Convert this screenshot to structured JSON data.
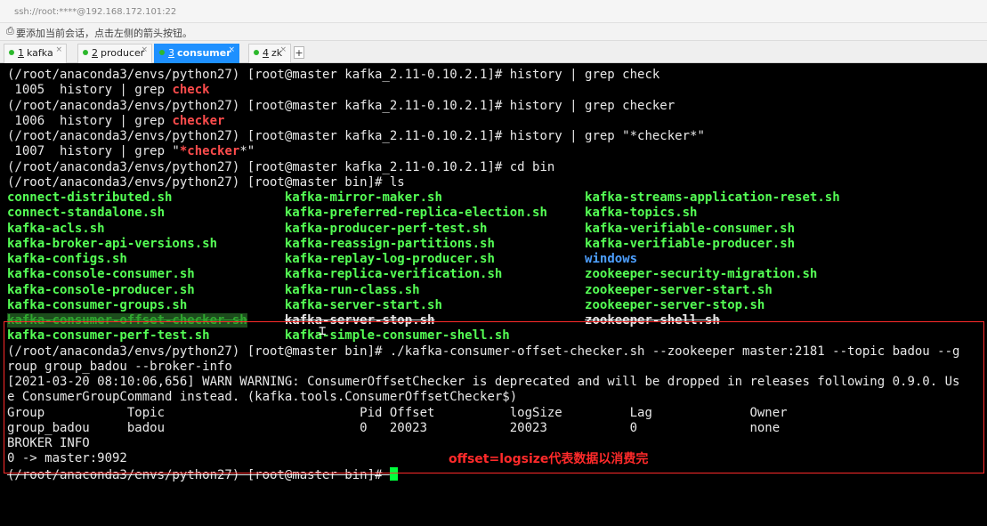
{
  "window": {
    "address": "ssh://root:****@192.168.172.101:22",
    "tip": "要添加当前会话，点击左侧的箭头按钮。"
  },
  "tabs": [
    {
      "num": "1",
      "label": "kafka",
      "active": false
    },
    {
      "num": "2",
      "label": "producer",
      "active": false
    },
    {
      "num": "3",
      "label": "consumer",
      "active": true
    },
    {
      "num": "4",
      "label": "zk",
      "active": false
    }
  ],
  "tab_add": "+",
  "terminal": {
    "l1": "(/root/anaconda3/envs/python27) [root@master kafka_2.11-0.10.2.1]# history | grep check",
    "l2a": " 1005  history | grep ",
    "l2b": "check",
    "l3": "(/root/anaconda3/envs/python27) [root@master kafka_2.11-0.10.2.1]# history | grep checker",
    "l4a": " 1006  history | grep ",
    "l4b": "checker",
    "l5": "(/root/anaconda3/envs/python27) [root@master kafka_2.11-0.10.2.1]# history | grep \"*checker*\"",
    "l6a": " 1007  history | grep \"",
    "l6b": "*checker",
    "l6c": "*\"",
    "l7": "(/root/anaconda3/envs/python27) [root@master kafka_2.11-0.10.2.1]# cd bin",
    "l8": "(/root/anaconda3/envs/python27) [root@master bin]# ls",
    "ls": [
      [
        "connect-distributed.sh",
        "kafka-mirror-maker.sh",
        "kafka-streams-application-reset.sh"
      ],
      [
        "connect-standalone.sh",
        "kafka-preferred-replica-election.sh",
        "kafka-topics.sh"
      ],
      [
        "kafka-acls.sh",
        "kafka-producer-perf-test.sh",
        "kafka-verifiable-consumer.sh"
      ],
      [
        "kafka-broker-api-versions.sh",
        "kafka-reassign-partitions.sh",
        "kafka-verifiable-producer.sh"
      ],
      [
        "kafka-configs.sh",
        "kafka-replay-log-producer.sh",
        "windows"
      ],
      [
        "kafka-console-consumer.sh",
        "kafka-replica-verification.sh",
        "zookeeper-security-migration.sh"
      ],
      [
        "kafka-console-producer.sh",
        "kafka-run-class.sh",
        "zookeeper-server-start.sh"
      ],
      [
        "kafka-consumer-groups.sh",
        "kafka-server-start.sh",
        "zookeeper-server-stop.sh"
      ],
      [
        "kafka-consumer-offset-checker.sh",
        "kafka-server-stop.sh",
        "zookeeper-shell.sh"
      ],
      [
        "kafka-consumer-perf-test.sh",
        "kafka-simple-consumer-shell.sh",
        ""
      ]
    ],
    "cmd1": "(/root/anaconda3/envs/python27) [root@master bin]# ./kafka-consumer-offset-checker.sh --zookeeper master:2181 --topic badou --g",
    "cmd2": "roup group_badou --broker-info",
    "warn1": "[2021-03-20 08:10:06,656] WARN WARNING: ConsumerOffsetChecker is deprecated and will be dropped in releases following 0.9.0. Us",
    "warn2": "e ConsumerGroupCommand instead. (kafka.tools.ConsumerOffsetChecker$)",
    "header": "Group           Topic                          Pid Offset          logSize         Lag             Owner",
    "row": "group_badou     badou                          0   20023           20023           0               none",
    "broker_title": "BROKER INFO",
    "broker": "0 -> master:9092",
    "prompt": "(/root/anaconda3/envs/python27) [root@master bin]# "
  },
  "annotation": "offset=logsize代表数据以消费完",
  "colors": {
    "exe": "#55ff55",
    "dir": "#4d9fff",
    "highlight": "#ff4c4c",
    "box": "#ff2a2a",
    "tab_active": "#1e90ff"
  }
}
